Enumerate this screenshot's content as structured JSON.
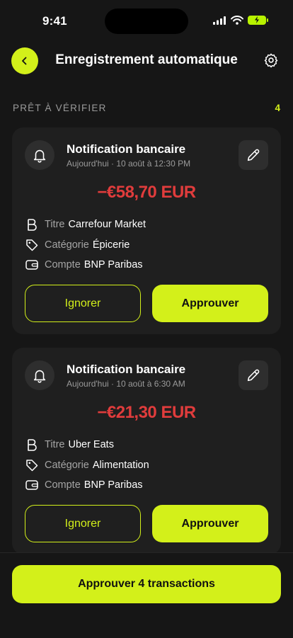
{
  "status_bar": {
    "time": "9:41"
  },
  "header": {
    "title": "Enregistrement automatique"
  },
  "section": {
    "label": "PRÊT À VÉRIFIER",
    "count": "4"
  },
  "cards": [
    {
      "title": "Notification bancaire",
      "time": "Aujourd'hui · 10 août à 12:30 PM",
      "amount": "−€58,70 EUR",
      "fields": [
        {
          "label": "Titre",
          "value": "Carrefour Market"
        },
        {
          "label": "Catégorie",
          "value": "Épicerie"
        },
        {
          "label": "Compte",
          "value": "BNP Paribas"
        }
      ],
      "ignore_label": "Ignorer",
      "approve_label": "Approuver"
    },
    {
      "title": "Notification bancaire",
      "time": "Aujourd'hui · 10 août à 6:30 AM",
      "amount": "−€21,30 EUR",
      "fields": [
        {
          "label": "Titre",
          "value": "Uber Eats"
        },
        {
          "label": "Catégorie",
          "value": "Alimentation"
        },
        {
          "label": "Compte",
          "value": "BNP Paribas"
        }
      ],
      "ignore_label": "Ignorer",
      "approve_label": "Approuver"
    }
  ],
  "footer": {
    "approve_all_label": "Approuver 4 transactions"
  },
  "colors": {
    "accent": "#d3f01a",
    "negative": "#e03c3c",
    "background": "#161616",
    "card": "#1f1f1f"
  },
  "icons": [
    "back-chevron-icon",
    "gear-icon",
    "bell-icon",
    "pencil-icon",
    "title-icon",
    "tag-icon",
    "wallet-icon",
    "signal-icon",
    "wifi-icon",
    "battery-icon"
  ]
}
